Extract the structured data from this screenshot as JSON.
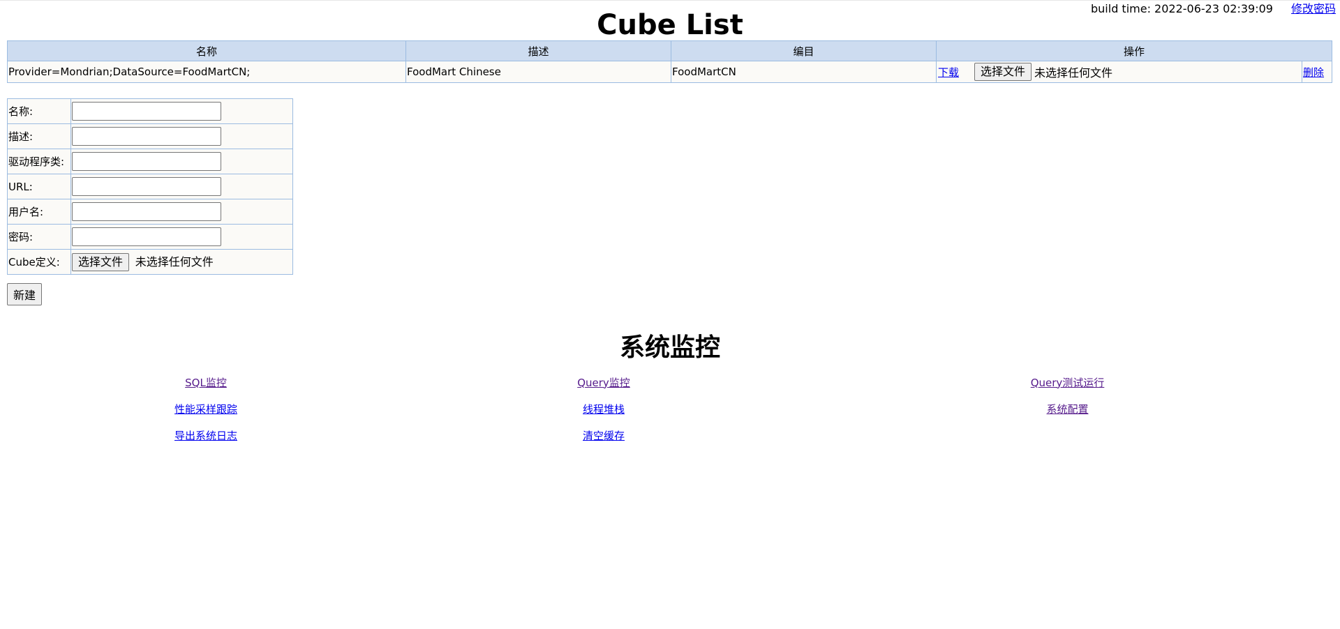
{
  "header": {
    "build_time": "build time: 2022-06-23 02:39:09",
    "change_password": "修改密码"
  },
  "page_title": "Cube List",
  "cube_table": {
    "columns": [
      "名称",
      "描述",
      "编目",
      "操作"
    ],
    "rows": [
      {
        "name": "Provider=Mondrian;DataSource=FoodMartCN;",
        "description": "FoodMart Chinese",
        "catalog": "FoodMartCN",
        "download": "下载",
        "choose_file": "选择文件",
        "no_file": "未选择任何文件",
        "delete": "删除"
      }
    ]
  },
  "form": {
    "name_label": "名称:",
    "desc_label": "描述:",
    "driver_label": "驱动程序类:",
    "url_label": "URL:",
    "user_label": "用户名:",
    "password_label": "密码:",
    "cube_def_label": "Cube定义:",
    "choose_file": "选择文件",
    "no_file": "未选择任何文件",
    "name_value": "",
    "desc_value": "",
    "driver_value": "",
    "url_value": "",
    "user_value": "",
    "password_value": "",
    "submit_label": "新建"
  },
  "monitor": {
    "title": "系统监控",
    "links": [
      [
        "SQL监控",
        "Query监控",
        "Query测试运行"
      ],
      [
        "性能采样跟踪",
        "线程堆栈",
        "系统配置"
      ],
      [
        "导出系统日志",
        "清空缓存"
      ]
    ]
  }
}
